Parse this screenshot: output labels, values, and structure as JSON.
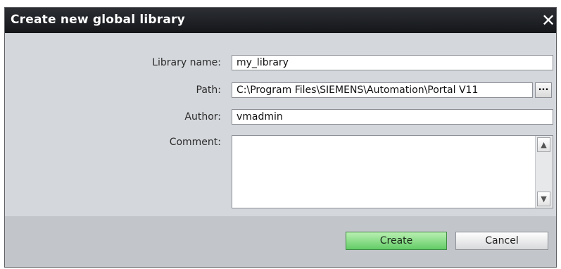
{
  "dialog": {
    "title": "Create new global library",
    "close_glyph": "✕"
  },
  "form": {
    "library_name_label": "Library name:",
    "library_name_value": "my_library",
    "path_label": "Path:",
    "path_value": "C:\\Program Files\\SIEMENS\\Automation\\Portal V11",
    "browse_label": "...",
    "author_label": "Author:",
    "author_value": "vmadmin",
    "comment_label": "Comment:",
    "comment_value": ""
  },
  "scrollbar": {
    "up_glyph": "▲",
    "down_glyph": "▼"
  },
  "footer": {
    "create_label": "Create",
    "cancel_label": "Cancel"
  },
  "colors": {
    "titlebar": "#1f2226",
    "dialog_bg": "#d4d7db",
    "footer_bg": "#c2c5ca",
    "create_button": "#7fd97d"
  },
  "icons": {
    "close": "close-icon",
    "browse": "browse-icon",
    "scroll_up": "chevron-up-icon",
    "scroll_down": "chevron-down-icon"
  }
}
